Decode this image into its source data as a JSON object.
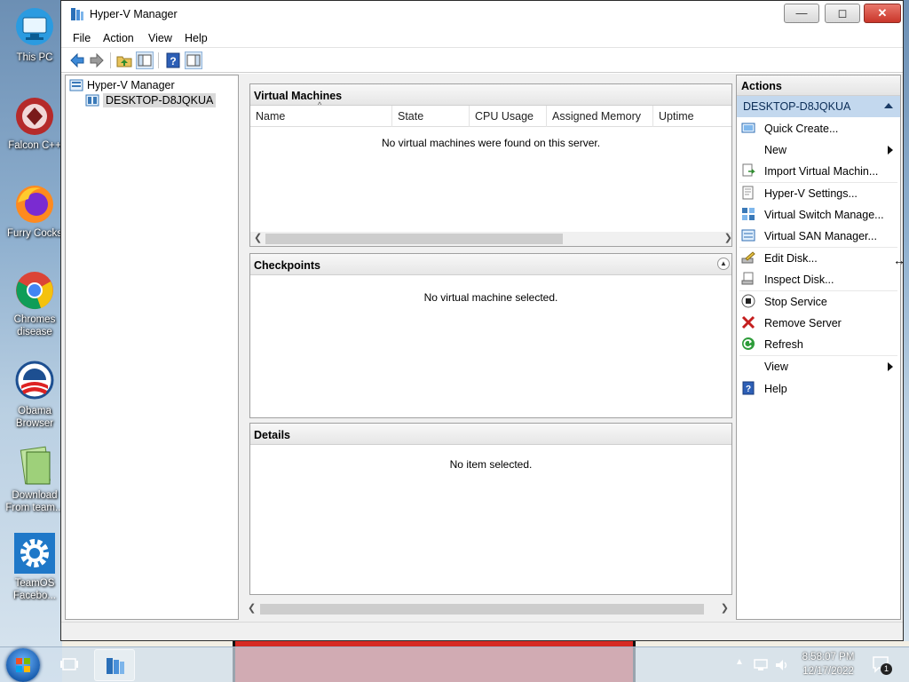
{
  "desktop": {
    "icons": [
      {
        "label": "This PC",
        "icon": "monitor-icon"
      },
      {
        "label": "Falcon C++",
        "icon": "falcon-app-icon"
      },
      {
        "label": "Furry Cocks",
        "icon": "firefox-icon"
      },
      {
        "label": "Chromes disease",
        "icon": "chrome-icon"
      },
      {
        "label": "Obama Browser",
        "icon": "obama-logo-icon"
      },
      {
        "label": "Download From team...",
        "icon": "notepad-icon"
      },
      {
        "label": "TeamOS Facebo...",
        "icon": "gear-icon"
      }
    ]
  },
  "window": {
    "title": "Hyper-V Manager",
    "menu": [
      "File",
      "Action",
      "View",
      "Help"
    ]
  },
  "tree": {
    "root": "Hyper-V Manager",
    "server": "DESKTOP-D8JQKUA"
  },
  "virtual_machines": {
    "title": "Virtual Machines",
    "columns": [
      "Name",
      "State",
      "CPU Usage",
      "Assigned Memory",
      "Uptime"
    ],
    "empty_message": "No virtual machines were found on this server."
  },
  "checkpoints": {
    "title": "Checkpoints",
    "empty_message": "No virtual machine selected."
  },
  "details": {
    "title": "Details",
    "empty_message": "No item selected."
  },
  "actions": {
    "title": "Actions",
    "section": "DESKTOP-D8JQKUA",
    "items": [
      {
        "label": "Quick Create...",
        "icon": "quick-create-icon"
      },
      {
        "label": "New",
        "icon": "",
        "submenu": true
      },
      {
        "label": "Import Virtual Machin...",
        "icon": "import-vm-icon"
      },
      {
        "label": "Hyper-V Settings...",
        "icon": "settings-icon"
      },
      {
        "label": "Virtual Switch Manage...",
        "icon": "virtual-switch-icon"
      },
      {
        "label": "Virtual SAN Manager...",
        "icon": "virtual-san-icon"
      },
      {
        "label": "Edit Disk...",
        "icon": "edit-disk-icon"
      },
      {
        "label": "Inspect Disk...",
        "icon": "inspect-disk-icon"
      },
      {
        "label": "Stop Service",
        "icon": "stop-icon"
      },
      {
        "label": "Remove Server",
        "icon": "remove-x-icon"
      },
      {
        "label": "Refresh",
        "icon": "refresh-icon"
      },
      {
        "label": "View",
        "icon": "",
        "submenu": true
      },
      {
        "label": "Help",
        "icon": "help-icon"
      }
    ]
  },
  "taskbar": {
    "time": "8:58:07 PM",
    "date": "12/17/2022",
    "notification_count": "1"
  },
  "colors": {
    "selection": "#c3d8ee",
    "close_button": "#c9362a"
  }
}
